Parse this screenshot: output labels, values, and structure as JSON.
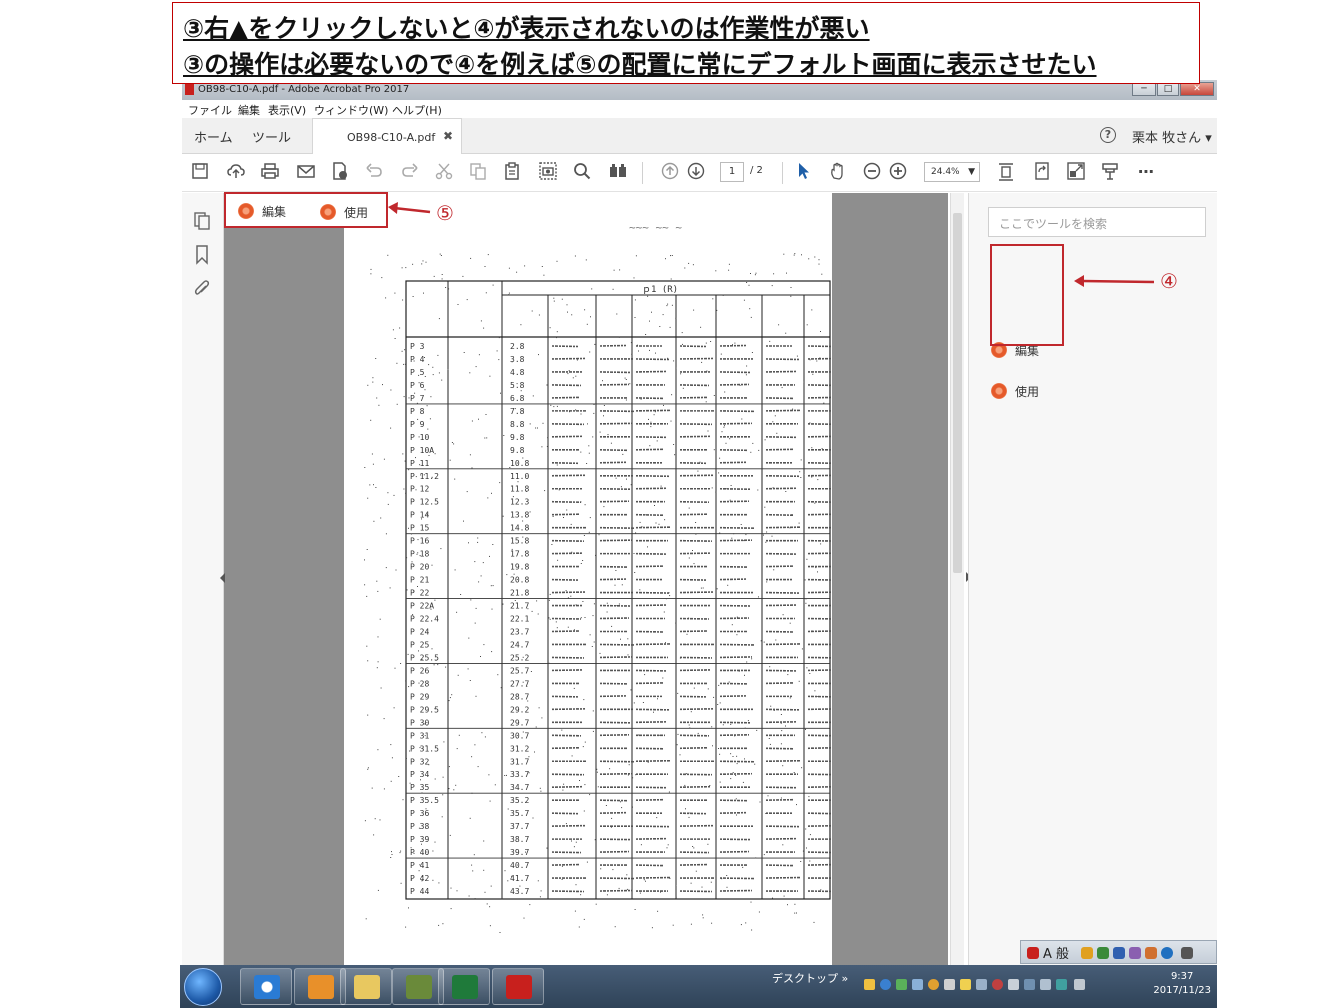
{
  "annotation": {
    "line1": "③右▲をクリックしないと④が表示されないのは作業性が悪い",
    "line2": "③の操作は必要ないので④を例えば⑤の配置に常にデフォルト画面に表示させたい",
    "marker4": "④",
    "marker5": "⑤"
  },
  "window": {
    "title": "OB98-C10-A.pdf - Adobe Acrobat Pro 2017",
    "controls": [
      "─",
      "□",
      "✕"
    ]
  },
  "menu": [
    "ファイル",
    "編集",
    "表示(V)",
    "ウィンドウ(W)",
    "ヘルプ(H)"
  ],
  "tabs": {
    "home": "ホーム",
    "tools": "ツール",
    "document": "OB98-C10-A.pdf",
    "close": "✖"
  },
  "user": {
    "help": "?",
    "name": "栗本 牧さん ▾"
  },
  "toolbar": {
    "page_current": "1",
    "page_total": "/ 2",
    "zoom": "24.4%",
    "zoom_dd": "▼",
    "icons": [
      "save-icon",
      "upload-icon",
      "print-icon",
      "mail-icon",
      "export-icon",
      "undo-icon",
      "redo-icon",
      "cut-icon",
      "copy-icon",
      "clipboard-icon",
      "snapshot-icon",
      "find-icon",
      "read-mode-icon",
      "page-up-icon",
      "page-down-icon",
      "select-icon",
      "hand-icon",
      "zoom-out-icon",
      "zoom-in-icon",
      "fit-page-icon",
      "rotate-icon",
      "full-screen-icon",
      "stamp-icon",
      "more-icon"
    ]
  },
  "quick_tools": {
    "edit": "編集",
    "use": "使用"
  },
  "right_pane": {
    "search_placeholder": "ここでツールを検索",
    "tools": [
      {
        "label": "編集"
      },
      {
        "label": "使用"
      }
    ]
  },
  "scan": {
    "header_code": "ｐ1 (R)",
    "rows": [
      "P 3",
      "P 4",
      "P 5",
      "P 6",
      "P 7",
      "P 8",
      "P 9",
      "P 10",
      "P 10A",
      "P 11",
      "P 11.2",
      "P 12",
      "P 12.5",
      "P 14",
      "P 15",
      "P 16",
      "P 18",
      "P 20",
      "P 21",
      "P 22",
      "P 22A",
      "P 22.4",
      "P 24",
      "P 25",
      "P 25.5",
      "P 26",
      "P 28",
      "P 29",
      "P 29.5",
      "P 30",
      "P 31",
      "P 31.5",
      "P 32",
      "P 34",
      "P 35",
      "P 35.5",
      "P 36",
      "P 38",
      "P 39",
      "P 40",
      "P 41",
      "P 42",
      "P 44"
    ],
    "dims": [
      "2.8",
      "3.8",
      "4.8",
      "5.8",
      "6.8",
      "7.8",
      "8.8",
      "9.8",
      "9.8",
      "10.8",
      "11.0",
      "11.8",
      "12.3",
      "13.8",
      "14.8",
      "15.8",
      "17.8",
      "19.8",
      "20.8",
      "21.8",
      "21.7",
      "22.1",
      "23.7",
      "24.7",
      "25.2",
      "25.7",
      "27.7",
      "28.7",
      "29.2",
      "29.7",
      "30.7",
      "31.2",
      "31.7",
      "33.7",
      "34.7",
      "35.2",
      "35.7",
      "37.7",
      "38.7",
      "39.7",
      "40.7",
      "41.7",
      "43.7"
    ]
  },
  "taskbar": {
    "desktop": "デスクトップ",
    "time": "9:37",
    "date": "2017/11/23",
    "ime": "A 般"
  }
}
